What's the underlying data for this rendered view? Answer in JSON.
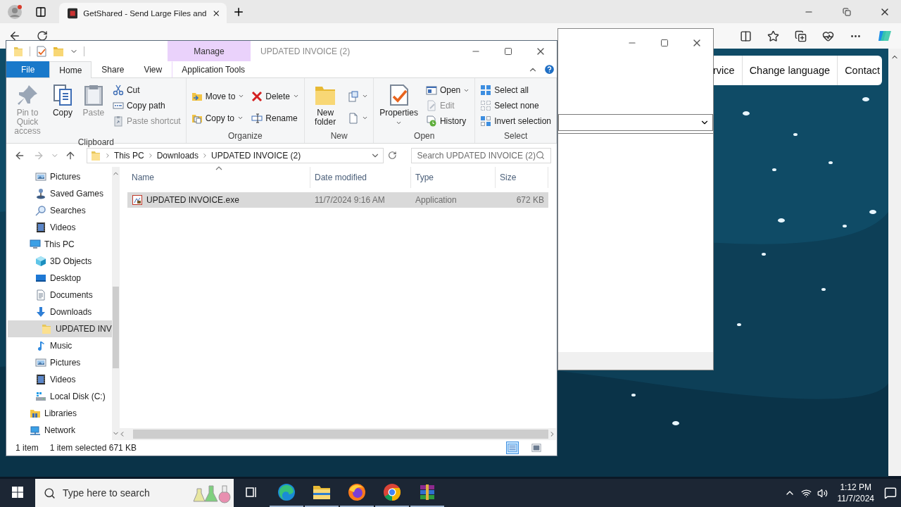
{
  "browser": {
    "tab": {
      "title": "GetShared - Send Large Files and"
    },
    "site_nav": [
      "rvice",
      "Change language",
      "Contact"
    ]
  },
  "explorer": {
    "title": "UPDATED INVOICE (2)",
    "context_tab": "Manage",
    "tabs": [
      {
        "label": "File",
        "kind": "file",
        "selected": false
      },
      {
        "label": "Home",
        "kind": "tab",
        "selected": true
      },
      {
        "label": "Share",
        "kind": "tab",
        "selected": false
      },
      {
        "label": "View",
        "kind": "tab",
        "selected": false
      },
      {
        "label": "Application Tools",
        "kind": "context",
        "selected": false
      }
    ],
    "ribbon": [
      {
        "name": "Clipboard",
        "columns": [
          [
            {
              "label": "Pin to Quick access",
              "kind": "large",
              "disabled": true,
              "dropdown": false
            }
          ],
          [
            {
              "label": "Copy",
              "kind": "large",
              "disabled": false,
              "dropdown": false
            }
          ],
          [
            {
              "label": "Paste",
              "kind": "large",
              "disabled": true,
              "dropdown": false
            }
          ],
          [
            {
              "label": "Cut",
              "kind": "small",
              "disabled": false,
              "dropdown": false
            },
            {
              "label": "Copy path",
              "kind": "small",
              "disabled": false,
              "dropdown": false
            },
            {
              "label": "Paste shortcut",
              "kind": "small",
              "disabled": true,
              "dropdown": false
            }
          ]
        ]
      },
      {
        "name": "Organize",
        "columns": [
          [
            {
              "label": "Move to",
              "kind": "small",
              "disabled": false,
              "dropdown": true
            },
            {
              "label": "Copy to",
              "kind": "small",
              "disabled": false,
              "dropdown": true
            }
          ],
          [
            {
              "label": "Delete",
              "kind": "small",
              "disabled": false,
              "dropdown": true
            },
            {
              "label": "Rename",
              "kind": "small",
              "disabled": false,
              "dropdown": false
            }
          ]
        ]
      },
      {
        "name": "New",
        "columns": [
          [
            {
              "label": "New folder",
              "kind": "large",
              "disabled": false,
              "dropdown": false
            }
          ],
          [
            {
              "kind": "icon",
              "disabled": false,
              "dropdown": true
            },
            {
              "kind": "icon",
              "disabled": false,
              "dropdown": true
            }
          ]
        ]
      },
      {
        "name": "Open",
        "columns": [
          [
            {
              "label": "Properties",
              "kind": "large",
              "disabled": false,
              "dropdown": true
            }
          ],
          [
            {
              "label": "Open",
              "kind": "small",
              "disabled": false,
              "dropdown": true
            },
            {
              "label": "Edit",
              "kind": "small",
              "disabled": true,
              "dropdown": false
            },
            {
              "label": "History",
              "kind": "small",
              "disabled": false,
              "dropdown": false
            }
          ]
        ]
      },
      {
        "name": "Select",
        "columns": [
          [
            {
              "label": "Select all",
              "kind": "small",
              "disabled": false,
              "dropdown": false
            },
            {
              "label": "Select none",
              "kind": "small",
              "disabled": false,
              "dropdown": false
            },
            {
              "label": "Invert selection",
              "kind": "small",
              "disabled": false,
              "dropdown": false
            }
          ]
        ]
      }
    ],
    "breadcrumb": [
      "This PC",
      "Downloads",
      "UPDATED INVOICE (2)"
    ],
    "search": {
      "placeholder": "Search UPDATED INVOICE (2)"
    },
    "nav": [
      {
        "children": [
          {
            "label": "Pictures",
            "kind": "pictures",
            "selected": false
          },
          {
            "label": "Saved Games",
            "kind": "games",
            "selected": false
          },
          {
            "label": "Searches",
            "kind": "searches",
            "selected": false
          },
          {
            "label": "Videos",
            "kind": "videos",
            "selected": false
          }
        ]
      },
      {
        "label": "This PC",
        "kind": "pc",
        "selected": false,
        "children": [
          {
            "label": "3D Objects",
            "kind": "objects",
            "selected": false
          },
          {
            "label": "Desktop",
            "kind": "desktop",
            "selected": false
          },
          {
            "label": "Documents",
            "kind": "documents",
            "selected": false
          },
          {
            "label": "Downloads",
            "kind": "downloads",
            "selected": false,
            "children": [
              {
                "label": "UPDATED INV",
                "kind": "folder",
                "selected": true
              }
            ]
          },
          {
            "label": "Music",
            "kind": "music",
            "selected": false
          },
          {
            "label": "Pictures",
            "kind": "pictures",
            "selected": false
          },
          {
            "label": "Videos",
            "kind": "videos",
            "selected": false
          },
          {
            "label": "Local Disk (C:)",
            "kind": "disk",
            "selected": false
          }
        ]
      },
      {
        "label": "Libraries",
        "kind": "libraries",
        "selected": false
      },
      {
        "label": "Network",
        "kind": "network",
        "selected": false
      }
    ],
    "columns": [
      {
        "label": "Name",
        "sorted": true
      },
      {
        "label": "Date modified",
        "sorted": false
      },
      {
        "label": "Type",
        "sorted": false
      },
      {
        "label": "Size",
        "sorted": false
      }
    ],
    "rows": [
      {
        "name": "UPDATED INVOICE.exe",
        "date": "11/7/2024 9:16 AM",
        "type": "Application",
        "size": "672 KB",
        "selected": true
      }
    ],
    "status": {
      "count": "1 item",
      "selection": "1 item selected",
      "selection_size": "671 KB"
    },
    "views": [
      {
        "kind": "details",
        "selected": true
      },
      {
        "kind": "large",
        "selected": false
      }
    ]
  },
  "taskbar": {
    "search_placeholder": "Type here to search",
    "apps": [
      {
        "kind": "taskview",
        "running": false
      },
      {
        "kind": "edge",
        "running": true
      },
      {
        "kind": "explorer",
        "running": true
      },
      {
        "kind": "firefox",
        "running": true
      },
      {
        "kind": "chrome",
        "running": true
      },
      {
        "kind": "winrar",
        "running": true
      }
    ],
    "time": "1:12 PM",
    "date": "11/7/2024"
  }
}
